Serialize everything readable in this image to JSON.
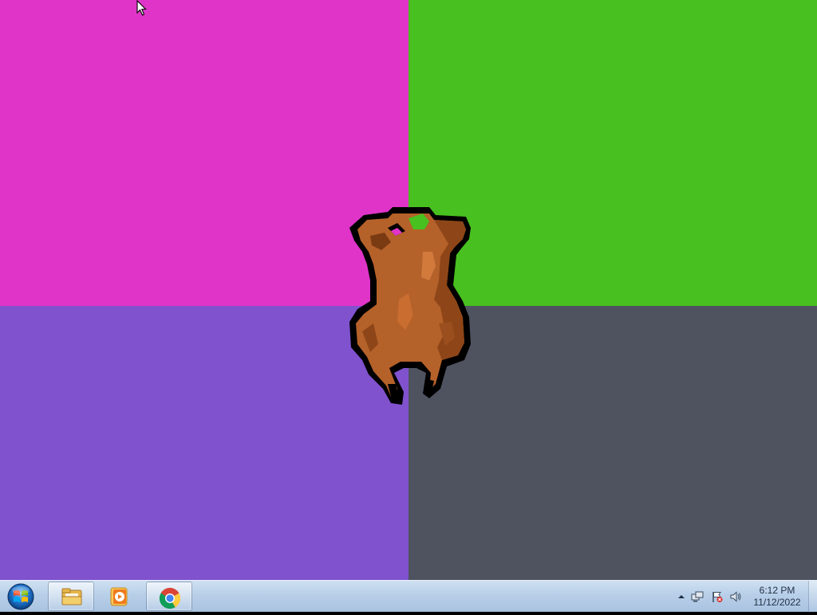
{
  "desktop": {
    "colors": {
      "top_left": "#e034c9",
      "top_right": "#48c01f",
      "bottom_left": "#8052ce",
      "bottom_right": "#4f5360"
    },
    "sprite": "roast-turkey-icon"
  },
  "taskbar": {
    "start_icon": "windows-start-orb-icon",
    "buttons": [
      {
        "name": "windows-explorer-button",
        "icon": "folder-icon"
      },
      {
        "name": "media-player-button",
        "icon": "media-player-icon"
      },
      {
        "name": "chrome-button",
        "icon": "chrome-icon"
      }
    ],
    "tray": {
      "icons": [
        "show-hidden-icons-arrow-icon",
        "network-icon",
        "action-center-flag-icon",
        "volume-icon"
      ],
      "time": "6:12 PM",
      "date": "11/12/2022"
    }
  }
}
